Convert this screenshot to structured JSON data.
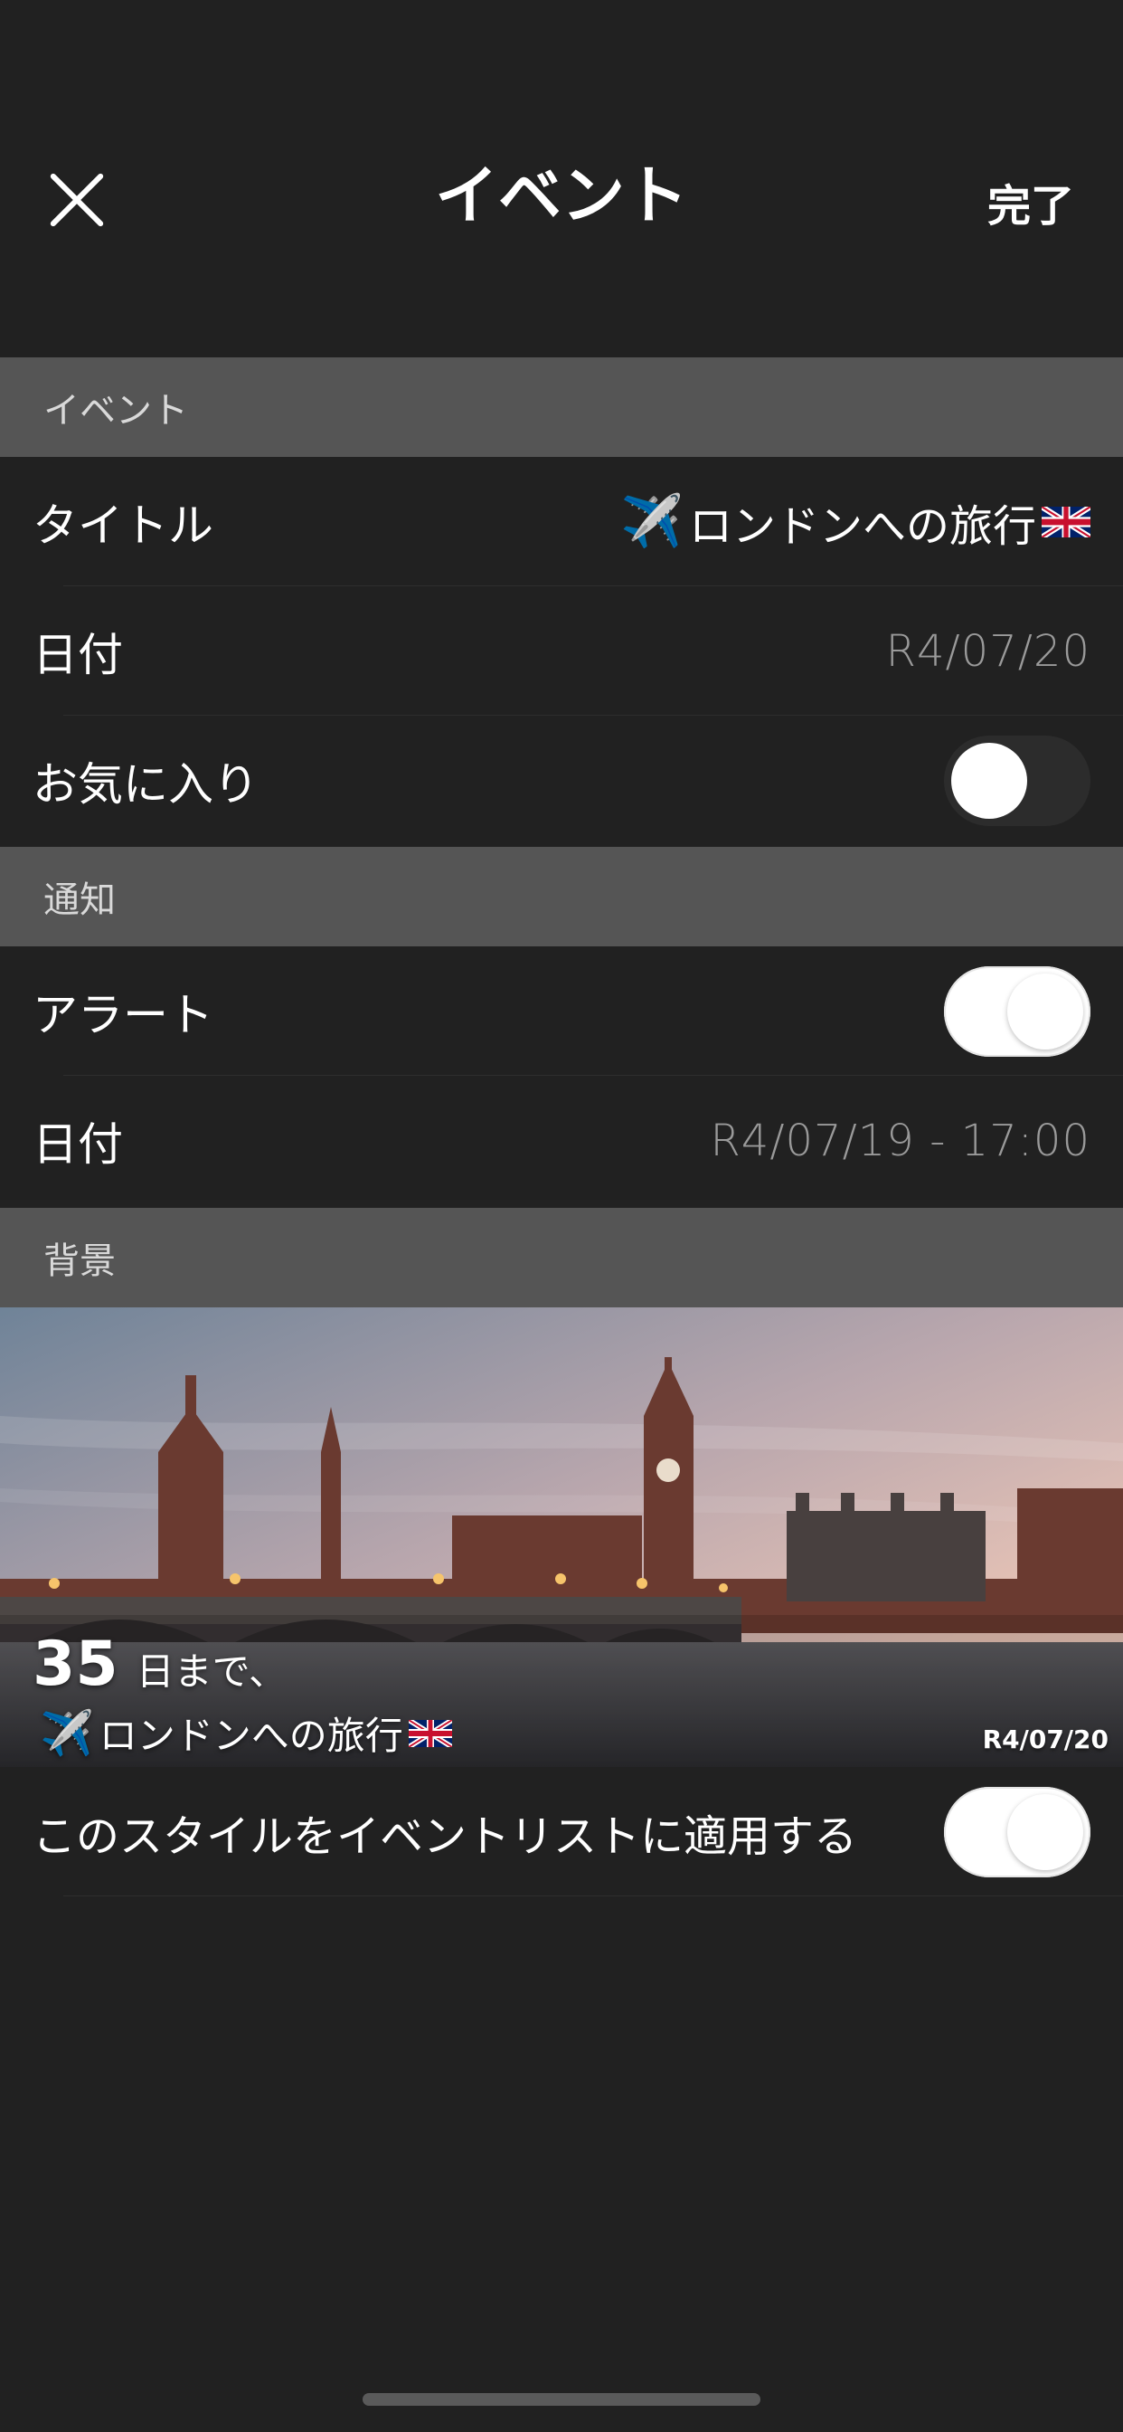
{
  "nav": {
    "title": "イベント",
    "done_label": "完了"
  },
  "sections": {
    "event_header": "イベント",
    "notify_header": "通知",
    "background_header": "背景"
  },
  "event": {
    "title_label": "タイトル",
    "title_icon": "✈️",
    "title_value": "ロンドンへの旅行",
    "title_flag_icon": "uk-flag-icon",
    "date_label": "日付",
    "date_value": "R4/07/20",
    "favorite_label": "お気に入り",
    "favorite_on": false
  },
  "notify": {
    "alert_label": "アラート",
    "alert_on": true,
    "date_label": "日付",
    "date_value": "R4/07/19 - 17:00"
  },
  "background": {
    "days": "35",
    "until_label": "日まで、",
    "title_icon": "✈️",
    "title": "ロンドンへの旅行",
    "date": "R4/07/20",
    "apply_label": "このスタイルをイベントリストに適用する",
    "apply_on": true
  },
  "colors": {
    "background": "#212121",
    "section_header": "#555555",
    "muted_text": "#9a9a9a"
  }
}
